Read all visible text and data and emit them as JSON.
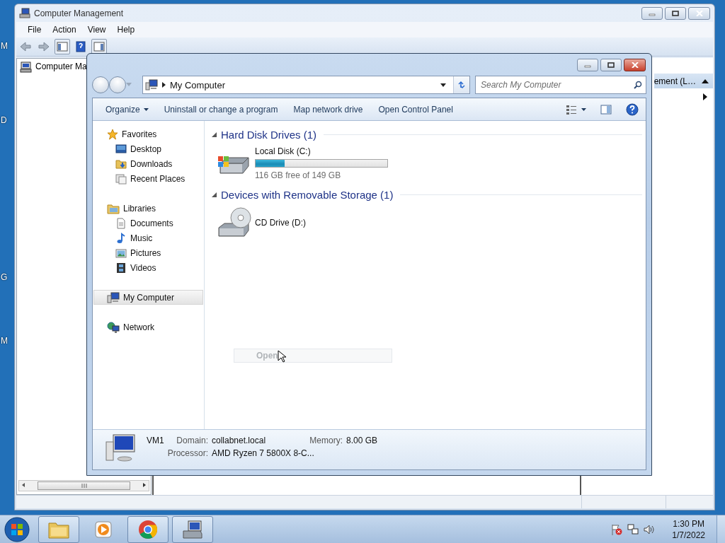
{
  "desktop": {
    "icon_labels": [
      "M",
      "D",
      "G",
      "M"
    ]
  },
  "management_window": {
    "title": "Computer Management",
    "menu": [
      "File",
      "Action",
      "View",
      "Help"
    ],
    "tree_item": "Computer Ma",
    "actions_header": "ement (L…"
  },
  "explorer_window": {
    "address": "My Computer",
    "search": {
      "placeholder": "Search My Computer"
    },
    "commands": [
      {
        "label": "Organize",
        "kind": "menu"
      },
      {
        "label": "Uninstall or change a program",
        "kind": "plain"
      },
      {
        "label": "Map network drive",
        "kind": "plain"
      },
      {
        "label": "Open Control Panel",
        "kind": "plain"
      }
    ],
    "nav": [
      {
        "label": "Favorites",
        "kind": "star",
        "selected": false,
        "children": [
          {
            "label": "Desktop",
            "kind": "desktop",
            "selected": false
          },
          {
            "label": "Downloads",
            "kind": "downloads",
            "selected": false
          },
          {
            "label": "Recent Places",
            "kind": "recent",
            "selected": false
          }
        ]
      },
      {
        "label": "Libraries",
        "kind": "library",
        "selected": false,
        "children": [
          {
            "label": "Documents",
            "kind": "document",
            "selected": false
          },
          {
            "label": "Music",
            "kind": "music",
            "selected": false
          },
          {
            "label": "Pictures",
            "kind": "pictures",
            "selected": false
          },
          {
            "label": "Videos",
            "kind": "videos",
            "selected": false
          }
        ]
      },
      {
        "label": "My Computer",
        "kind": "computer",
        "selected": true
      },
      {
        "label": "Network",
        "kind": "network",
        "selected": false
      }
    ],
    "groups": [
      {
        "title": "Hard Disk Drives (1)",
        "items": [
          {
            "name": "Local Disk (C:)",
            "kind": "disk",
            "level": 0.22,
            "reading": "116 GB free of 149 GB"
          }
        ]
      },
      {
        "title": "Devices with Removable Storage (1)",
        "items": [
          {
            "name": "CD Drive (D:)",
            "kind": "cd"
          }
        ]
      }
    ],
    "drag_label": "Open",
    "details": {
      "name": "VM1",
      "fields": [
        {
          "label": "Domain:",
          "value": "collabnet.local"
        },
        {
          "label": "Memory:",
          "value": "8.00 GB"
        },
        {
          "label": "Processor:",
          "value": "AMD Ryzen 7 5800X 8-C..."
        }
      ]
    }
  },
  "taskbar": {
    "buttons": [
      {
        "kind": "folder",
        "running": true
      },
      {
        "kind": "media",
        "running": false
      },
      {
        "kind": "browser",
        "running": true
      },
      {
        "kind": "management",
        "running": true
      }
    ],
    "clock_time": "1:30 PM",
    "clock_date": "1/7/2022"
  }
}
